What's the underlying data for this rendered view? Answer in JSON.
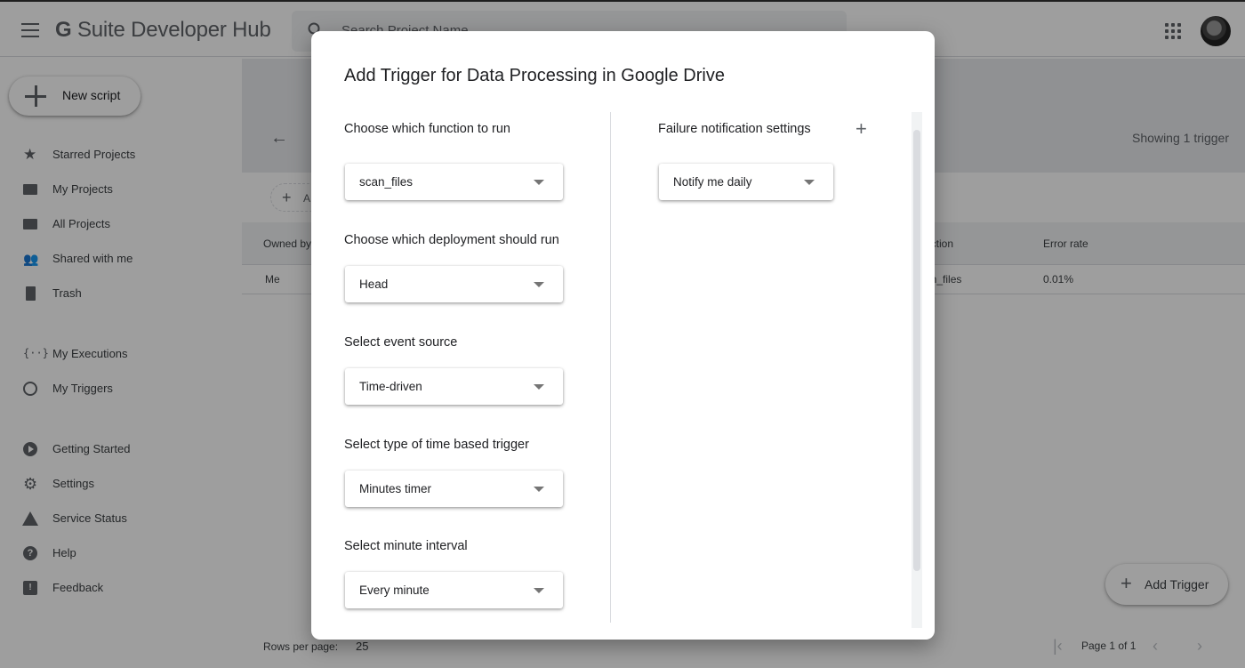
{
  "app": {
    "title_prefix": "G",
    "title_rest": "Suite Developer Hub",
    "search_placeholder": "Search Project Name"
  },
  "sidebar": {
    "new_script_label": "New script",
    "items": [
      {
        "label": "Starred Projects",
        "icon": "star-icon"
      },
      {
        "label": "My Projects",
        "icon": "folder-icon"
      },
      {
        "label": "All Projects",
        "icon": "folders-icon"
      },
      {
        "label": "Shared with me",
        "icon": "people-icon"
      },
      {
        "label": "Trash",
        "icon": "trash-icon"
      },
      {
        "label": "My Executions",
        "icon": "executions-icon"
      },
      {
        "label": "My Triggers",
        "icon": "alarm-icon"
      },
      {
        "label": "Getting Started",
        "icon": "play-icon"
      },
      {
        "label": "Settings",
        "icon": "gear-icon"
      },
      {
        "label": "Service Status",
        "icon": "warning-icon"
      },
      {
        "label": "Help",
        "icon": "help-icon"
      },
      {
        "label": "Feedback",
        "icon": "feedback-icon"
      }
    ]
  },
  "triggers_page": {
    "showing_text": "Showing 1 trigger",
    "add_chip_text": "A",
    "columns": {
      "owned_by": "Owned by",
      "function": "nction",
      "error_rate": "Error rate"
    },
    "row": {
      "owned_by": "Me",
      "function": "an_files",
      "error_rate": "0.01%"
    },
    "rows_per_page_label": "Rows per page:",
    "rows_per_page_value": "25",
    "page_label": "Page 1 of 1",
    "add_trigger_label": "Add Trigger"
  },
  "dialog": {
    "title": "Add Trigger for Data Processing in Google Drive",
    "fields": {
      "function": {
        "label": "Choose which function to run",
        "value": "scan_files"
      },
      "deployment": {
        "label": "Choose which deployment should run",
        "value": "Head"
      },
      "event_source": {
        "label": "Select event source",
        "value": "Time-driven"
      },
      "time_trigger": {
        "label": "Select type of time based trigger",
        "value": "Minutes timer"
      },
      "minute_interval": {
        "label": "Select minute interval",
        "value": "Every minute"
      }
    },
    "failure": {
      "label": "Failure notification settings",
      "value": "Notify me daily"
    }
  }
}
